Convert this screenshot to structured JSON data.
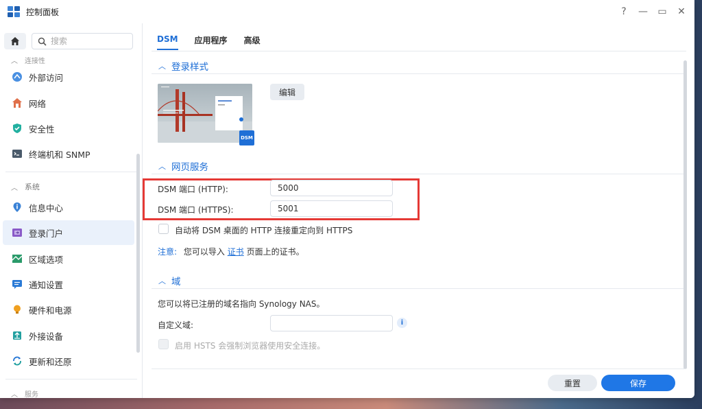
{
  "window": {
    "title": "控制面板",
    "controls": [
      "?",
      "—",
      "▭",
      "✕"
    ]
  },
  "sidebar": {
    "search_placeholder": "搜索",
    "partial_top": "连接性",
    "items": [
      {
        "label": "外部访问",
        "icon": "external-access-icon",
        "color": "#4a90e2",
        "active": false
      },
      {
        "label": "网络",
        "icon": "network-house-icon",
        "color": "#e0704a",
        "active": false
      },
      {
        "label": "安全性",
        "icon": "shield-icon",
        "color": "#22b0a0",
        "active": false
      },
      {
        "label": "终端机和 SNMP",
        "icon": "terminal-icon",
        "color": "#4a5a6a",
        "active": false
      }
    ],
    "group_system": "系统",
    "system_items": [
      {
        "label": "信息中心",
        "icon": "info-pin-icon",
        "color": "#3a82d6",
        "active": false
      },
      {
        "label": "登录门户",
        "icon": "login-portal-icon",
        "color": "#8a5ac8",
        "active": true
      },
      {
        "label": "区域选项",
        "icon": "region-map-icon",
        "color": "#2a9a6a",
        "active": false
      },
      {
        "label": "通知设置",
        "icon": "notification-icon",
        "color": "#2a7ad6",
        "active": false
      },
      {
        "label": "硬件和电源",
        "icon": "lightbulb-icon",
        "color": "#f0a020",
        "active": false
      },
      {
        "label": "外接设备",
        "icon": "external-device-icon",
        "color": "#22a0a0",
        "active": false
      },
      {
        "label": "更新和还原",
        "icon": "update-restore-icon",
        "color": "#2a7ad6",
        "active": false
      }
    ],
    "partial_bottom": "服务"
  },
  "tabs": [
    {
      "label": "DSM",
      "active": true
    },
    {
      "label": "应用程序",
      "active": false
    },
    {
      "label": "高级",
      "active": false
    }
  ],
  "login_style": {
    "heading": "登录样式",
    "edit_button": "编辑",
    "badge": "DSM"
  },
  "web_service": {
    "heading": "网页服务",
    "http_label": "DSM 端口 (HTTP):",
    "http_value": "5000",
    "https_label": "DSM 端口 (HTTPS):",
    "https_value": "5001",
    "redirect_label": "自动将 DSM 桌面的 HTTP 连接重定向到 HTTPS",
    "note_key": "注意:",
    "note_pre": "您可以导入",
    "note_link": "证书",
    "note_post": "页面上的证书。"
  },
  "domain": {
    "heading": "域",
    "description": "您可以将已注册的域名指向 Synology NAS。",
    "custom_label": "自定义域:",
    "custom_value": "",
    "hsts_label": "启用 HSTS 会强制浏览器使用安全连接。"
  },
  "footer": {
    "reset": "重置",
    "save": "保存"
  },
  "colors": {
    "accent": "#1f6fd6",
    "highlight": "#e53935"
  }
}
